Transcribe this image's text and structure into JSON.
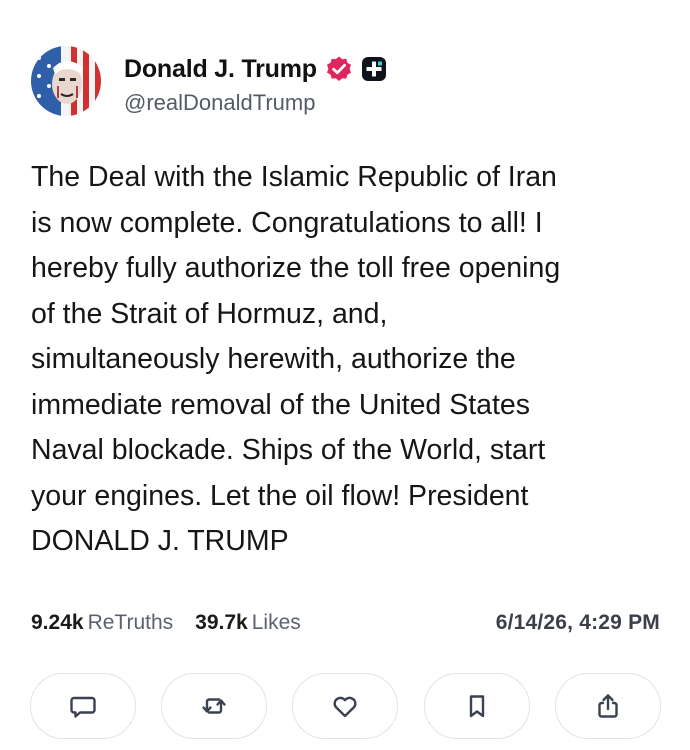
{
  "author": {
    "display_name": "Donald J. Trump",
    "handle": "@realDonaldTrump",
    "verified_color": "#e0245e"
  },
  "post": {
    "text": "The Deal with the Islamic Republic of Iran\nis now complete. Congratulations to all! I\nhereby fully authorize the toll free opening\nof the Strait of Hormuz, and,\nsimultaneously herewith, authorize the\nimmediate removal of the United States\nNaval blockade. Ships of the World, start\nyour engines. Let the oil flow! President\nDONALD J. TRUMP"
  },
  "stats": {
    "retruths_count": "9.24k",
    "retruths_label": "ReTruths",
    "likes_count": "39.7k",
    "likes_label": "Likes",
    "timestamp": "6/14/26, 4:29 PM"
  },
  "actions": [
    {
      "icon": "reply-icon"
    },
    {
      "icon": "retruth-icon"
    },
    {
      "icon": "like-icon"
    },
    {
      "icon": "bookmark-icon"
    },
    {
      "icon": "share-icon"
    }
  ]
}
